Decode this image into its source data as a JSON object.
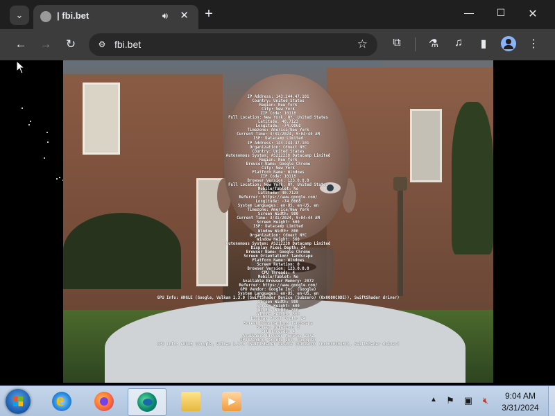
{
  "browser": {
    "tab_title": "| fbi.bet",
    "url": "fbi.bet",
    "icons": {
      "tab_search": "chevron-down-icon",
      "favicon": "globe-icon",
      "audio": "speaker-icon",
      "tab_close": "close-icon",
      "new_tab": "plus-icon",
      "back": "arrow-left-icon",
      "forward": "arrow-right-icon",
      "reload": "reload-icon",
      "site_info": "tune-icon",
      "bookmark": "star-icon",
      "extensions": "puzzle-icon",
      "labs": "flask-icon",
      "media": "media-control-icon",
      "side_panel": "side-panel-icon",
      "profile": "profile-icon",
      "menu": "kebab-menu-icon"
    }
  },
  "page": {
    "info_lines": [
      "IP Address: 143.244.47.101",
      "Country: United States",
      "Region: New York",
      "City: New York",
      "ZIP Code: 10118",
      "Full Location: New York, NY, United States",
      "Latitude: 40.7123",
      "Longitude: -74.0068",
      "Timezone: America/New York",
      "Current Time: 3/31/2024, 9:04:40 AM",
      "ISP: Datacamp Limited",
      "IP Address: 143.244.47.101",
      "Organization: Cdnext NYC",
      "Country: United States",
      "Autonomous System: AS212238 Datacamp Limited",
      "Region: New York",
      "Browser Name: Google Chrome",
      "City: New York",
      "Platform Name: Windows",
      "ZIP Code: 10118",
      "Browser Version: 123.0.0.0",
      "Full Location: New York, NY, United States",
      "Mobile/Tablet: No",
      "Latitude: 40.7123",
      "Referrer: https://www.google.com/",
      "Longitude: -74.0068",
      "System Languages: en-US, en-US, en",
      "Timezone: America/New York",
      "Screen Width: 800",
      "Current Time: 3/31/2024, 9:04:44 AM",
      "Screen Height: 600",
      "ISP: Datacamp Limited",
      "Window Width: 800",
      "Organization: Cdnext NYC",
      "Window Height: 560",
      "Autonomous System: AS212238 Datacamp Limited",
      "Display Pixel Depth: 24",
      "Browser Name: Google Chrome",
      "Screen Orientation: landscape",
      "Platform Name: Windows",
      "Screen Rotation: 0",
      "Browser Version: 123.0.0.0",
      "CPU Threads: 4",
      "Mobile/Tablet: No",
      "Available Browser Memory: 2072",
      "Referrer: https://www.google.com/",
      "GPU Vendor: Google Inc. (Google)",
      "System Languages: en-US, en-US, en",
      "GPU Info: ANGLE (Google, Vulkan 1.3.0 (SwiftShader Device (Subzero) (0x0000C0DE)), SwiftShader driver)",
      "Screen Width: 800",
      "Screen Height: 600",
      "Window Width: 800",
      "Window Height: 560",
      "Display Pixel Depth: 24",
      "Screen Orientation: landscape",
      "Screen Rotation: 0",
      "CPU Threads: 4",
      "Available Browser Memory: 2072",
      "GPU Vendor: Google Inc. (Google)",
      "GPU Info: ANGLE (Google, Vulkan 1.3.0 (SwiftShader Device (Subzero) (0x0000C0DE)), SwiftShader driver)"
    ]
  },
  "taskbar": {
    "apps": [
      {
        "name": "internet-explorer-icon"
      },
      {
        "name": "firefox-icon"
      },
      {
        "name": "edge-icon"
      },
      {
        "name": "file-explorer-icon"
      },
      {
        "name": "media-player-icon"
      }
    ],
    "tray": {
      "icons": [
        "show-hidden-icons-icon",
        "action-center-flag-icon",
        "network-icon",
        "volume-muted-icon"
      ]
    },
    "clock": {
      "time": "9:04 AM",
      "date": "3/31/2024"
    }
  },
  "colors": {
    "tabbar": "#1f1f1f",
    "toolbar": "#3c3c3c",
    "omnibox": "#282828",
    "taskbar": "#b9cde4"
  }
}
